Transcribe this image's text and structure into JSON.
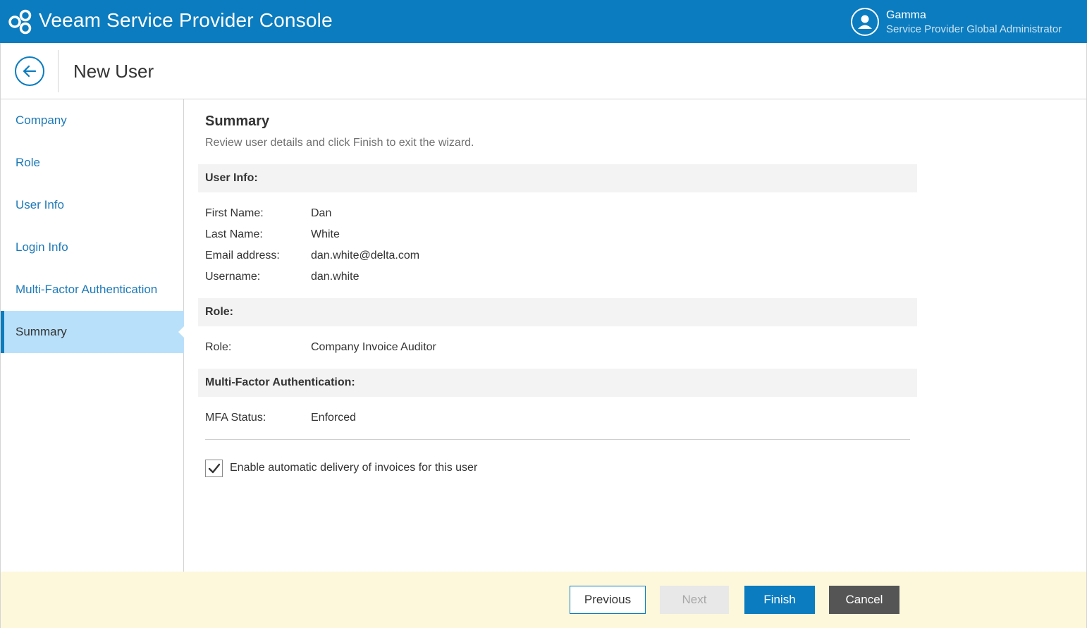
{
  "app": {
    "title": "Veeam Service Provider Console"
  },
  "user": {
    "name": "Gamma",
    "role": "Service Provider Global Administrator"
  },
  "header": {
    "title": "New User"
  },
  "sidebar": {
    "items": [
      {
        "label": "Company",
        "active": false
      },
      {
        "label": "Role",
        "active": false
      },
      {
        "label": "User Info",
        "active": false
      },
      {
        "label": "Login Info",
        "active": false
      },
      {
        "label": "Multi-Factor Authentication",
        "active": false
      },
      {
        "label": "Summary",
        "active": true
      }
    ]
  },
  "summary": {
    "title": "Summary",
    "description": "Review user details and click Finish to exit the wizard.",
    "user_info": {
      "header": "User Info:",
      "rows": [
        {
          "label": "First Name:",
          "value": "Dan"
        },
        {
          "label": "Last Name:",
          "value": "White"
        },
        {
          "label": "Email address:",
          "value": "dan.white@delta.com"
        },
        {
          "label": "Username:",
          "value": "dan.white"
        }
      ]
    },
    "role": {
      "header": "Role:",
      "rows": [
        {
          "label": "Role:",
          "value": "Company Invoice Auditor"
        }
      ]
    },
    "mfa": {
      "header": "Multi-Factor Authentication:",
      "rows": [
        {
          "label": "MFA Status:",
          "value": "Enforced"
        }
      ]
    },
    "checkbox": {
      "label": "Enable automatic delivery of invoices for this user",
      "checked": true
    }
  },
  "footer": {
    "previous_label": "Previous",
    "next_label": "Next",
    "finish_label": "Finish",
    "cancel_label": "Cancel"
  },
  "colors": {
    "brand": "#0a7cbf",
    "active_nav": "#b9e0fa",
    "footer_bg": "#fdf8dc"
  }
}
